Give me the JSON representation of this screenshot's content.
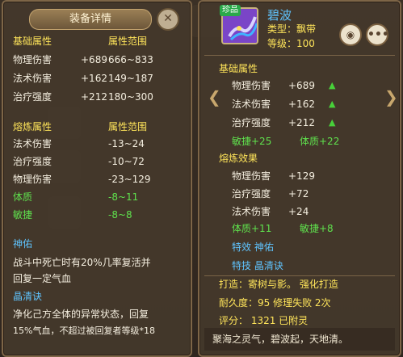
{
  "left": {
    "title": "装备详情",
    "close": "✕",
    "base_head": [
      "基础属性",
      "属性范围"
    ],
    "base_rows": [
      {
        "name": "物理伤害",
        "val": "+689",
        "range": "666~833"
      },
      {
        "name": "法术伤害",
        "val": "+162",
        "range": "149~187"
      },
      {
        "name": "治疗强度",
        "val": "+212",
        "range": "180~300"
      }
    ],
    "refine_head": [
      "熔炼属性",
      "属性范围"
    ],
    "refine_rows": [
      {
        "name": "法术伤害",
        "range": "-13~24",
        "color": "white"
      },
      {
        "name": "治疗强度",
        "range": "-10~72",
        "color": "white"
      },
      {
        "name": "物理伤害",
        "range": "-23~129",
        "color": "white"
      },
      {
        "name": "体质",
        "range": "-8~11",
        "color": "green"
      },
      {
        "name": "敏捷",
        "range": "-8~8",
        "color": "green"
      }
    ],
    "blessing_title": "神佑",
    "blessing_text": [
      "战斗中死亡时有20%几率复活并",
      "回复一定气血"
    ],
    "skill_title": "晶清诀",
    "skill_text": [
      "净化己方全体的异常状态，回复",
      "15%气血，不超过被回复者等级*18"
    ]
  },
  "right": {
    "badge": "珍品",
    "name": "碧波",
    "type_line": "类型：飘带",
    "level_line": "等级：100",
    "eye": "◉",
    "more": "•••",
    "base_head": "基础属性",
    "base_rows": [
      {
        "name": "物理伤害",
        "val": "+689"
      },
      {
        "name": "法术伤害",
        "val": "+162"
      },
      {
        "name": "治疗强度",
        "val": "+212"
      }
    ],
    "bonus_left": "敏捷+25",
    "bonus_right": "体质+22",
    "refine_head": "熔炼效果",
    "refine_rows": [
      {
        "name": "物理伤害",
        "val": "+129"
      },
      {
        "name": "治疗强度",
        "val": "+72"
      },
      {
        "name": "法术伤害",
        "val": "+24"
      }
    ],
    "refine_bonus_left": "体质+11",
    "refine_bonus_right": "敏捷+8",
    "special_effect": "特效  神佑",
    "special_skill": "特技  晶清诀",
    "forge_line": "打造：寄树与影。    强化打造",
    "durability_line": "耐久度：95  修理失败  2次",
    "score_line": "评分：  1321    已附灵",
    "footer": "聚海之灵气，碧波起，天地清。",
    "arrow_left": "❮",
    "arrow_right": "❯"
  }
}
